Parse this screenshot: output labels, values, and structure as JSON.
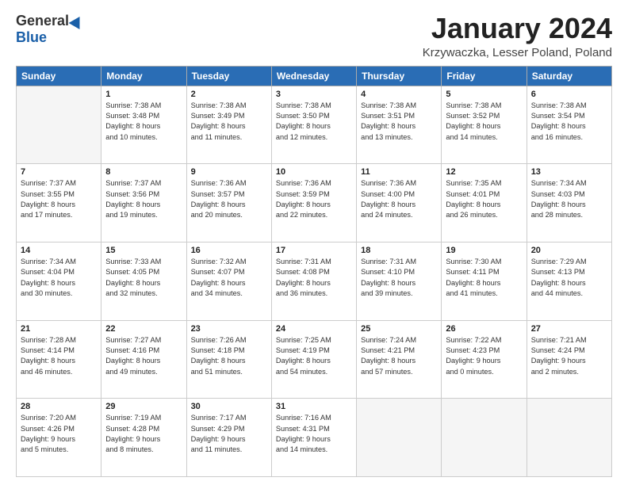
{
  "header": {
    "logo_general": "General",
    "logo_blue": "Blue",
    "month_title": "January 2024",
    "location": "Krzywaczka, Lesser Poland, Poland"
  },
  "weekdays": [
    "Sunday",
    "Monday",
    "Tuesday",
    "Wednesday",
    "Thursday",
    "Friday",
    "Saturday"
  ],
  "weeks": [
    [
      {
        "day": "",
        "info": ""
      },
      {
        "day": "1",
        "info": "Sunrise: 7:38 AM\nSunset: 3:48 PM\nDaylight: 8 hours\nand 10 minutes."
      },
      {
        "day": "2",
        "info": "Sunrise: 7:38 AM\nSunset: 3:49 PM\nDaylight: 8 hours\nand 11 minutes."
      },
      {
        "day": "3",
        "info": "Sunrise: 7:38 AM\nSunset: 3:50 PM\nDaylight: 8 hours\nand 12 minutes."
      },
      {
        "day": "4",
        "info": "Sunrise: 7:38 AM\nSunset: 3:51 PM\nDaylight: 8 hours\nand 13 minutes."
      },
      {
        "day": "5",
        "info": "Sunrise: 7:38 AM\nSunset: 3:52 PM\nDaylight: 8 hours\nand 14 minutes."
      },
      {
        "day": "6",
        "info": "Sunrise: 7:38 AM\nSunset: 3:54 PM\nDaylight: 8 hours\nand 16 minutes."
      }
    ],
    [
      {
        "day": "7",
        "info": "Sunrise: 7:37 AM\nSunset: 3:55 PM\nDaylight: 8 hours\nand 17 minutes."
      },
      {
        "day": "8",
        "info": "Sunrise: 7:37 AM\nSunset: 3:56 PM\nDaylight: 8 hours\nand 19 minutes."
      },
      {
        "day": "9",
        "info": "Sunrise: 7:36 AM\nSunset: 3:57 PM\nDaylight: 8 hours\nand 20 minutes."
      },
      {
        "day": "10",
        "info": "Sunrise: 7:36 AM\nSunset: 3:59 PM\nDaylight: 8 hours\nand 22 minutes."
      },
      {
        "day": "11",
        "info": "Sunrise: 7:36 AM\nSunset: 4:00 PM\nDaylight: 8 hours\nand 24 minutes."
      },
      {
        "day": "12",
        "info": "Sunrise: 7:35 AM\nSunset: 4:01 PM\nDaylight: 8 hours\nand 26 minutes."
      },
      {
        "day": "13",
        "info": "Sunrise: 7:34 AM\nSunset: 4:03 PM\nDaylight: 8 hours\nand 28 minutes."
      }
    ],
    [
      {
        "day": "14",
        "info": "Sunrise: 7:34 AM\nSunset: 4:04 PM\nDaylight: 8 hours\nand 30 minutes."
      },
      {
        "day": "15",
        "info": "Sunrise: 7:33 AM\nSunset: 4:05 PM\nDaylight: 8 hours\nand 32 minutes."
      },
      {
        "day": "16",
        "info": "Sunrise: 7:32 AM\nSunset: 4:07 PM\nDaylight: 8 hours\nand 34 minutes."
      },
      {
        "day": "17",
        "info": "Sunrise: 7:31 AM\nSunset: 4:08 PM\nDaylight: 8 hours\nand 36 minutes."
      },
      {
        "day": "18",
        "info": "Sunrise: 7:31 AM\nSunset: 4:10 PM\nDaylight: 8 hours\nand 39 minutes."
      },
      {
        "day": "19",
        "info": "Sunrise: 7:30 AM\nSunset: 4:11 PM\nDaylight: 8 hours\nand 41 minutes."
      },
      {
        "day": "20",
        "info": "Sunrise: 7:29 AM\nSunset: 4:13 PM\nDaylight: 8 hours\nand 44 minutes."
      }
    ],
    [
      {
        "day": "21",
        "info": "Sunrise: 7:28 AM\nSunset: 4:14 PM\nDaylight: 8 hours\nand 46 minutes."
      },
      {
        "day": "22",
        "info": "Sunrise: 7:27 AM\nSunset: 4:16 PM\nDaylight: 8 hours\nand 49 minutes."
      },
      {
        "day": "23",
        "info": "Sunrise: 7:26 AM\nSunset: 4:18 PM\nDaylight: 8 hours\nand 51 minutes."
      },
      {
        "day": "24",
        "info": "Sunrise: 7:25 AM\nSunset: 4:19 PM\nDaylight: 8 hours\nand 54 minutes."
      },
      {
        "day": "25",
        "info": "Sunrise: 7:24 AM\nSunset: 4:21 PM\nDaylight: 8 hours\nand 57 minutes."
      },
      {
        "day": "26",
        "info": "Sunrise: 7:22 AM\nSunset: 4:23 PM\nDaylight: 9 hours\nand 0 minutes."
      },
      {
        "day": "27",
        "info": "Sunrise: 7:21 AM\nSunset: 4:24 PM\nDaylight: 9 hours\nand 2 minutes."
      }
    ],
    [
      {
        "day": "28",
        "info": "Sunrise: 7:20 AM\nSunset: 4:26 PM\nDaylight: 9 hours\nand 5 minutes."
      },
      {
        "day": "29",
        "info": "Sunrise: 7:19 AM\nSunset: 4:28 PM\nDaylight: 9 hours\nand 8 minutes."
      },
      {
        "day": "30",
        "info": "Sunrise: 7:17 AM\nSunset: 4:29 PM\nDaylight: 9 hours\nand 11 minutes."
      },
      {
        "day": "31",
        "info": "Sunrise: 7:16 AM\nSunset: 4:31 PM\nDaylight: 9 hours\nand 14 minutes."
      },
      {
        "day": "",
        "info": ""
      },
      {
        "day": "",
        "info": ""
      },
      {
        "day": "",
        "info": ""
      }
    ]
  ]
}
